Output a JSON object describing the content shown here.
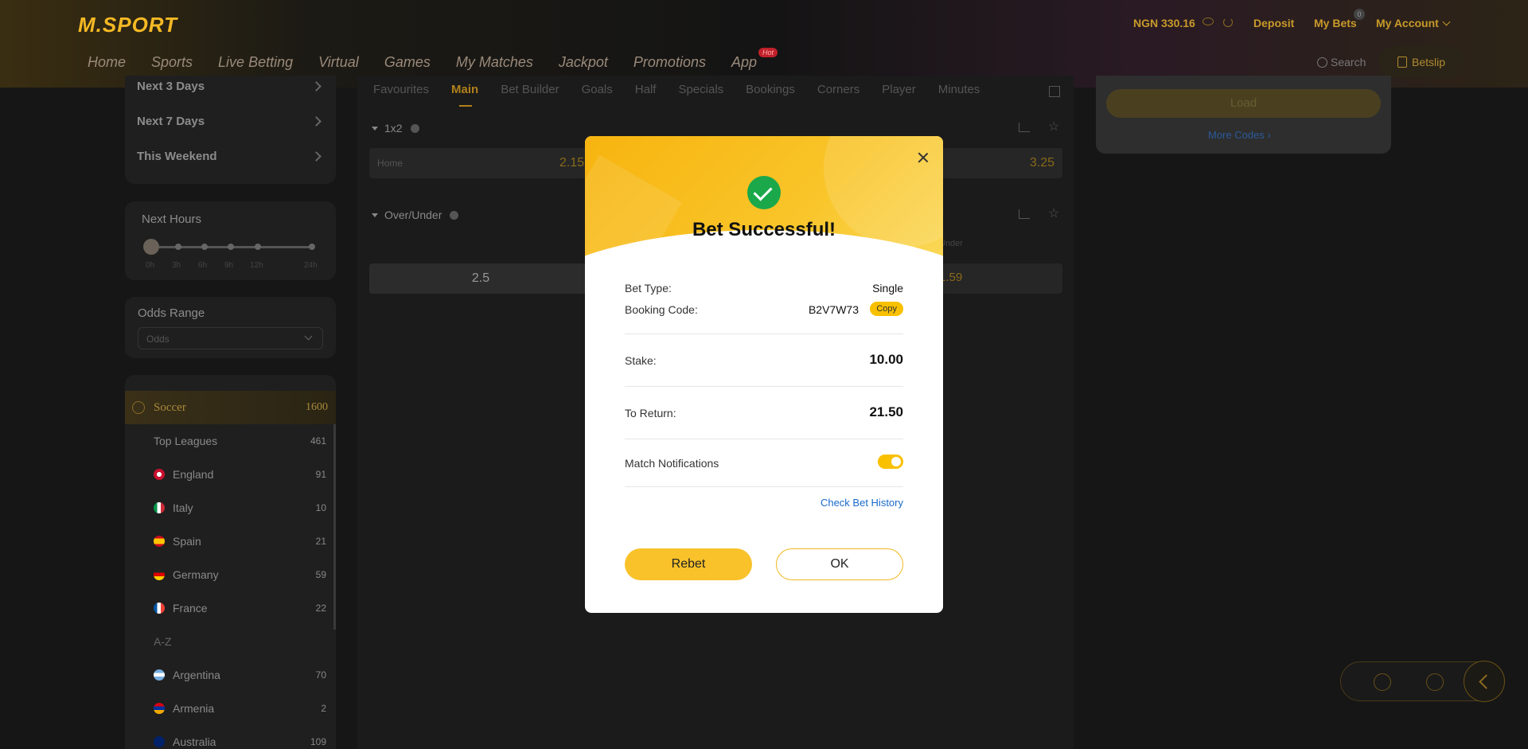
{
  "header": {
    "logo": "M.SPORT",
    "balance": "NGN 330.16",
    "deposit": "Deposit",
    "my_bets": "My Bets",
    "my_bets_badge": "0",
    "my_account": "My Account",
    "nav": [
      "Home",
      "Sports",
      "Live Betting",
      "Virtual",
      "Games",
      "My Matches",
      "Jackpot",
      "Promotions",
      "App"
    ],
    "app_badge": "Hot",
    "search": "Search",
    "betslip": "Betslip",
    "brand_color": "#f5b924"
  },
  "sidebar": {
    "period_links": [
      "Next 3 Days",
      "Next 7 Days",
      "This Weekend"
    ],
    "next_hours": {
      "title": "Next Hours",
      "ticks": [
        "0h",
        "3h",
        "6h",
        "9h",
        "12h",
        "24h"
      ]
    },
    "odds_range": {
      "title": "Odds Range",
      "placeholder": "Odds"
    },
    "sport": {
      "name": "Soccer",
      "count": "1600"
    },
    "leagues": [
      {
        "name": "Top Leagues",
        "count": "461"
      },
      {
        "name": "England",
        "count": "91"
      },
      {
        "name": "Italy",
        "count": "10"
      },
      {
        "name": "Spain",
        "count": "21"
      },
      {
        "name": "Germany",
        "count": "59"
      },
      {
        "name": "France",
        "count": "22"
      }
    ],
    "az_label": "A-Z",
    "countries": [
      {
        "name": "Argentina",
        "count": "70"
      },
      {
        "name": "Armenia",
        "count": "2"
      },
      {
        "name": "Australia",
        "count": "109"
      }
    ]
  },
  "main": {
    "tabs": [
      "Favourites",
      "Main",
      "Bet Builder",
      "Goals",
      "Half",
      "Specials",
      "Bookings",
      "Corners",
      "Player",
      "Minutes"
    ],
    "active_tab": "Main",
    "market_1x2": {
      "title": "1x2",
      "home_label": "Home",
      "home_odds": "2.15",
      "away_odds": "3.25"
    },
    "market_ou": {
      "title": "Over/Under",
      "under_label": "Under",
      "line": "2.5",
      "under_odds": "1.59"
    }
  },
  "right_panel": {
    "load": "Load",
    "more_codes": "More Codes"
  },
  "modal": {
    "title": "Bet Successful!",
    "bet_type_label": "Bet Type:",
    "bet_type_value": "Single",
    "booking_code_label": "Booking Code:",
    "booking_code_value": "B2V7W73",
    "copy": "Copy",
    "stake_label": "Stake:",
    "stake_value": "10.00",
    "return_label": "To Return:",
    "return_value": "21.50",
    "notifications_label": "Match Notifications",
    "notifications_on": true,
    "history_link": "Check Bet History",
    "rebet": "Rebet",
    "ok": "OK",
    "success_color": "#1aa84a",
    "accent_color": "#f9c22a"
  }
}
